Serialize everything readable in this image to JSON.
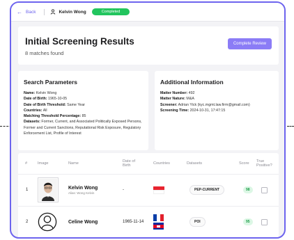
{
  "topbar": {
    "back_label": "Back",
    "user_name": "Kelvin Wong",
    "status_badge": "Completed"
  },
  "header": {
    "title": "Initial Screening Results",
    "subtitle": "8 matches found",
    "complete_button": "Complete Review"
  },
  "search_parameters": {
    "heading": "Search Parameters",
    "fields": [
      {
        "label": "Name:",
        "value": "Kelvin Wong"
      },
      {
        "label": "Date of Birth:",
        "value": "1965-10-05"
      },
      {
        "label": "Date of Birth Threshold:",
        "value": "Same Year"
      },
      {
        "label": "Countries:",
        "value": "All"
      },
      {
        "label": "Matching Threshold Percentage:",
        "value": "85"
      },
      {
        "label": "Datasets:",
        "value": "Former, Current, and Associated Politically Exposed Persons, Former and Current Sanctions, Reputational Risk Exposure, Regulatory Enforcement List, Profile of Interest"
      }
    ]
  },
  "additional_info": {
    "heading": "Additional Information",
    "fields": [
      {
        "label": "Matter Number:",
        "value": "492"
      },
      {
        "label": "Matter Nature:",
        "value": "M&A"
      },
      {
        "label": "Screener:",
        "value": "Adrian Yick (kyc.mgmt.law.firm@gmail.com)"
      },
      {
        "label": "Screening Time:",
        "value": "2024-10-31, 17:47:15"
      }
    ]
  },
  "table": {
    "columns": [
      "#",
      "Image",
      "Name",
      "Date of Birth",
      "Countries",
      "Datasets",
      "Score",
      "True Positive?"
    ],
    "rows": [
      {
        "index": "1",
        "name": "Kelvin Wong",
        "alias": "Alias: Wong Kelvin",
        "dob": "-",
        "countries": [
          "Singapore"
        ],
        "dataset": "PEP-CURRENT",
        "score": "98"
      },
      {
        "index": "2",
        "name": "Celine Wong",
        "alias": "",
        "dob": "1965-11-14",
        "countries": [
          "France",
          "Cambodia"
        ],
        "dataset": "POI",
        "score": "95"
      }
    ]
  },
  "colors": {
    "accent": "#6c63ee",
    "completed_green": "#22c55e",
    "button_purple": "#8b7cf6",
    "score_green": "#1e9e4a"
  }
}
